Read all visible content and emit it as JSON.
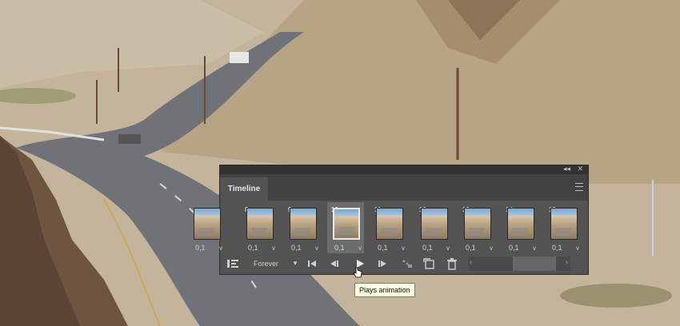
{
  "window": {
    "title": "Timeline"
  },
  "panel": {
    "header": {
      "collapse_icon": "double-chevron-icon",
      "close_icon": "close-icon"
    },
    "tab_label": "Timeline",
    "frames": [
      {
        "number": "",
        "delay": "0,1"
      },
      {
        "number": "8",
        "delay": "0,1"
      },
      {
        "number": "9",
        "delay": "0,1"
      },
      {
        "number": "10",
        "delay": "0,1",
        "selected": true
      },
      {
        "number": "11",
        "delay": "0,1"
      },
      {
        "number": "12",
        "delay": "0,1"
      },
      {
        "number": "13",
        "delay": "0,1"
      },
      {
        "number": "14",
        "delay": "0,1"
      },
      {
        "number": "15",
        "delay": "0,1"
      }
    ],
    "toolbar": {
      "loop_option": "Forever",
      "icons": [
        "convert-timeline-icon",
        "first-frame-icon",
        "previous-frame-icon",
        "play-icon",
        "next-frame-icon",
        "tween-icon",
        "duplicate-frame-icon",
        "delete-frame-icon"
      ]
    }
  },
  "tooltip": {
    "text": "Plays animation"
  }
}
